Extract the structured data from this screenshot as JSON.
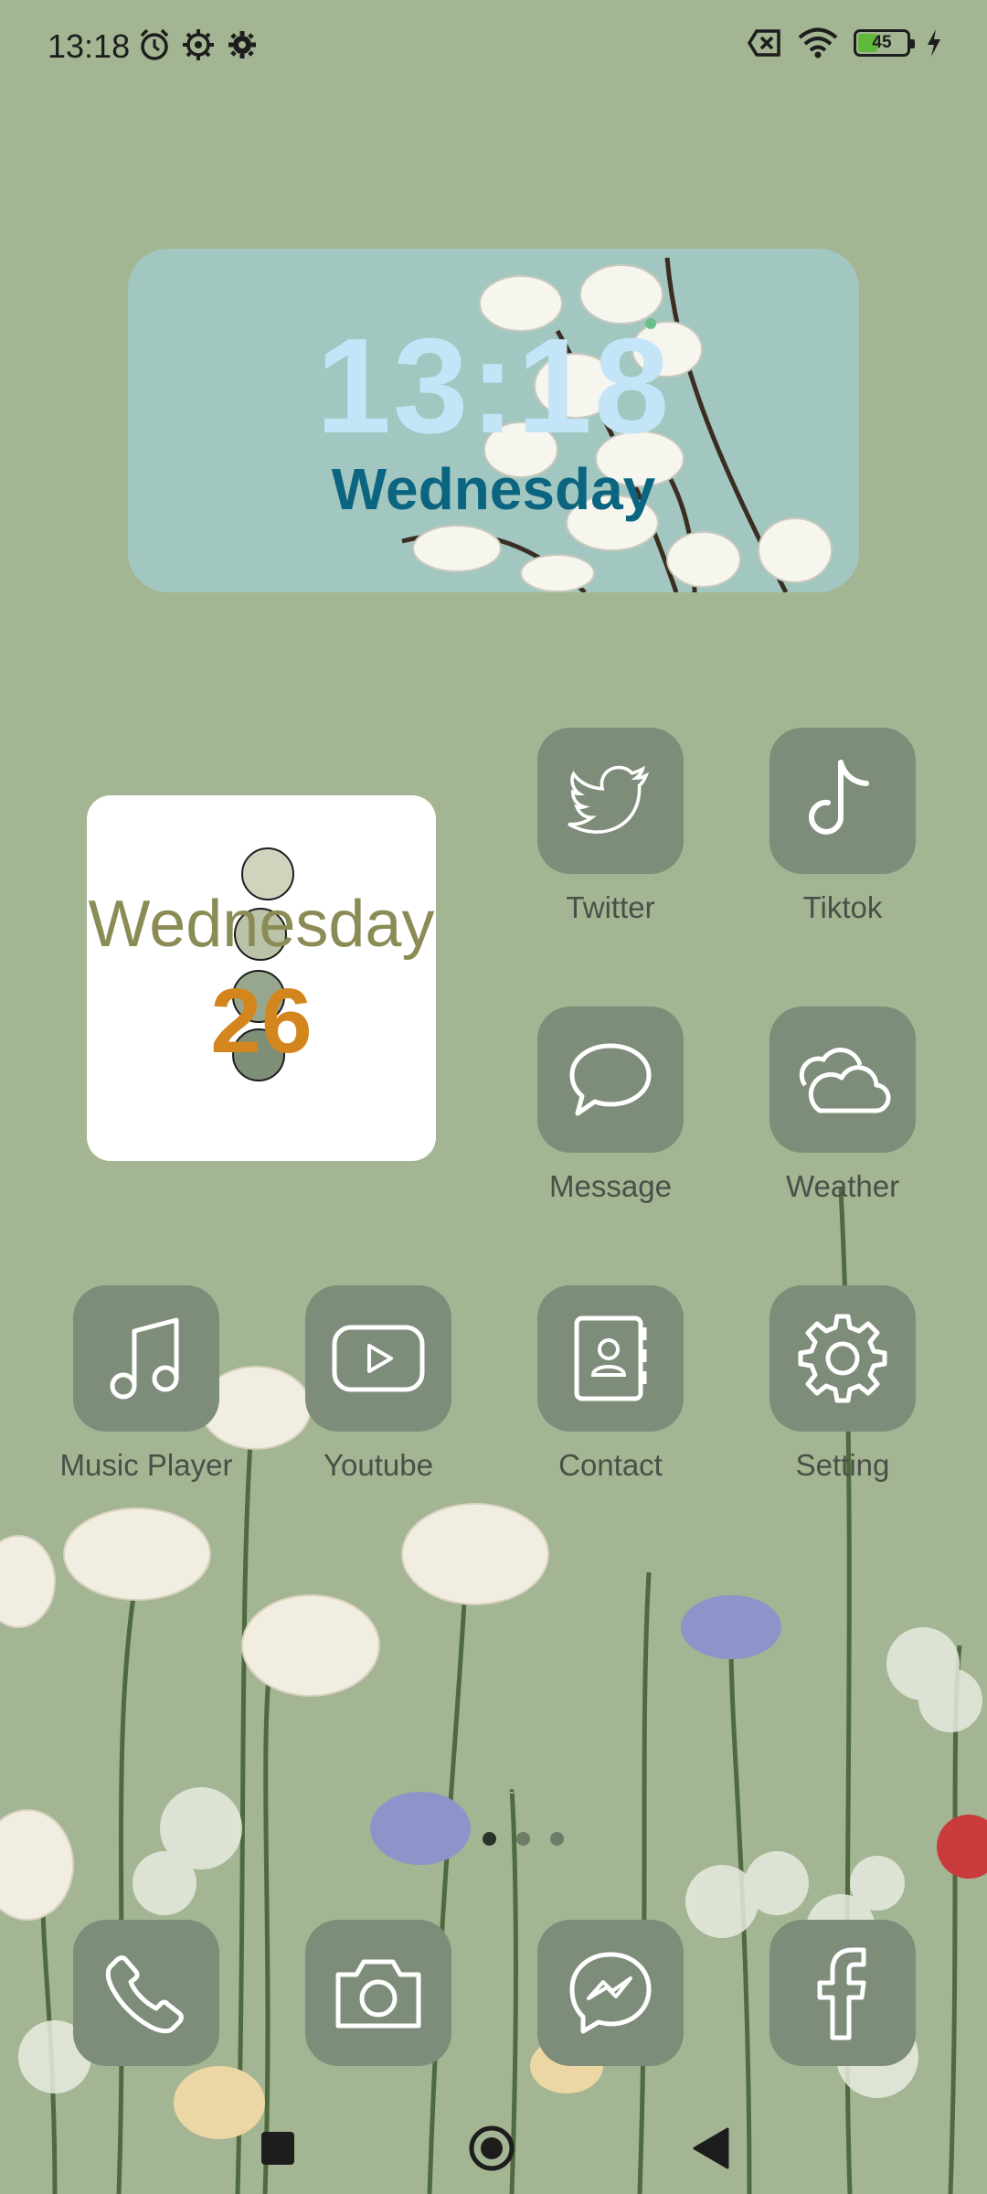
{
  "status_bar": {
    "time": "13:18",
    "battery_level": "45",
    "battery_fraction": 0.45,
    "left_icons": [
      "alarm-icon",
      "gear-outline-icon",
      "gear-icon"
    ],
    "right_icons": [
      "no-sim-icon",
      "wifi-icon",
      "battery-icon",
      "charging-icon"
    ]
  },
  "clock_widget": {
    "time": "13:18",
    "day": "Wednesday"
  },
  "calendar_widget": {
    "day": "Wednesday",
    "date": "26"
  },
  "apps": [
    {
      "label": "Twitter",
      "icon": "twitter-icon"
    },
    {
      "label": "Tiktok",
      "icon": "tiktok-icon"
    },
    {
      "label": "Message",
      "icon": "message-icon"
    },
    {
      "label": "Weather",
      "icon": "weather-icon"
    },
    {
      "label": "Music Player",
      "icon": "music-icon"
    },
    {
      "label": "Youtube",
      "icon": "youtube-icon"
    },
    {
      "label": "Contact",
      "icon": "contact-icon"
    },
    {
      "label": "Setting",
      "icon": "setting-icon"
    }
  ],
  "dock": [
    {
      "icon": "phone-icon"
    },
    {
      "icon": "camera-icon"
    },
    {
      "icon": "messenger-icon"
    },
    {
      "icon": "facebook-icon"
    }
  ],
  "pages": {
    "count": 3,
    "active": 0
  },
  "navigation": [
    "recents-button",
    "home-button",
    "back-button"
  ],
  "colors": {
    "wallpaper": "#a3b592",
    "app_tile": "#7e8d79",
    "clock_widget_bg": "#a2c7c0",
    "clock_time": "#c4e4f8",
    "clock_day": "#0b6480",
    "calendar_day": "#8b8c55",
    "calendar_date": "#d4861e"
  }
}
